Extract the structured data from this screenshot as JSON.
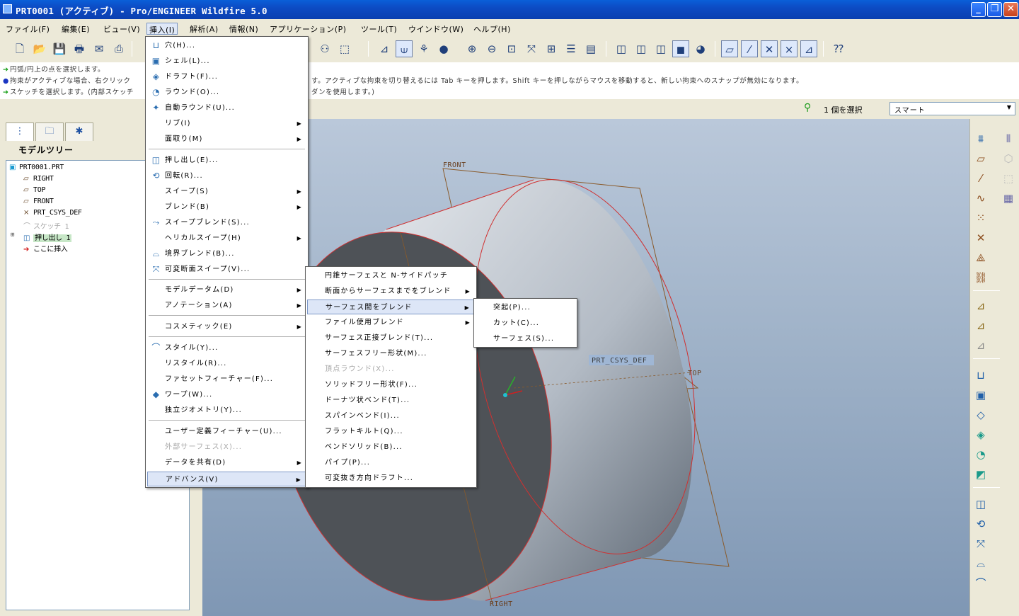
{
  "window": {
    "title": "PRT0001 (アクティブ) - Pro/ENGINEER Wildfire 5.0",
    "min": "_",
    "max": "❐",
    "close": "✕"
  },
  "menubar": [
    "ファイル(F)",
    "編集(E)",
    "ビュー(V)",
    "挿入(I)",
    "解析(A)",
    "情報(N)",
    "アプリケーション(P)",
    "ツール(T)",
    "ウインドウ(W)",
    "ヘルプ(H)"
  ],
  "messages": [
    "円弧/円上の点を選択します。",
    "拘束がアクティブな場合、右クリック",
    "スケッチを選択します。(内部スケッチ",
    "す。アクティブな拘束を切り替えるには Tab キーを押します。Shift キーを押しながらマウスを移動すると、新しい拘束へのスナップが無効になります。",
    "ダンを使用します。)"
  ],
  "selection": {
    "count": "1 個を選択",
    "filter": "スマート"
  },
  "tree": {
    "header": "モデルツリー",
    "items": [
      "PRT0001.PRT",
      "RIGHT",
      "TOP",
      "FRONT",
      "PRT_CSYS_DEF",
      "スケッチ 1",
      "押し出し 1",
      "ここに挿入"
    ]
  },
  "insert_menu": {
    "items": [
      "穴(H)...",
      "シェル(L)...",
      "ドラフト(F)...",
      "ラウンド(O)...",
      "自動ラウンド(U)...",
      "リブ(I)",
      "面取り(M)",
      "押し出し(E)...",
      "回転(R)...",
      "スイープ(S)",
      "ブレンド(B)",
      "スイープブレンド(S)...",
      "ヘリカルスイープ(H)",
      "境界ブレンド(B)...",
      "可変断面スイープ(V)...",
      "モデルデータム(D)",
      "アノテーション(A)",
      "コスメティック(E)",
      "スタイル(Y)...",
      "リスタイル(R)...",
      "ファセットフィーチャー(F)...",
      "ワープ(W)...",
      "独立ジオメトリ(Y)...",
      "ユーザー定義フィーチャー(U)...",
      "外部サーフェス(X)...",
      "データを共有(D)",
      "アドバンス(V)"
    ]
  },
  "advanced_menu": {
    "items": [
      "円錐サーフェスと N-サイドパッチ",
      "断面からサーフェスまでをブレンド",
      "サーフェス間をブレンド",
      "ファイル使用ブレンド",
      "サーフェス正接ブレンド(T)...",
      "サーフェスフリー形状(M)...",
      "頂点ラウンド(X)...",
      "ソリッドフリー形状(F)...",
      "ドーナツ状ベンド(T)...",
      "スパインベンド(I)...",
      "フラットキルト(Q)...",
      "ベンドソリッド(B)...",
      "パイプ(P)...",
      "可変抜き方向ドラフト..."
    ]
  },
  "blend_submenu": {
    "items": [
      "突起(P)...",
      "カット(C)...",
      "サーフェス(S)..."
    ]
  },
  "viewport": {
    "labels": [
      "FRONT",
      "TOP",
      "PRT_CSYS_DEF",
      "RIGHT"
    ]
  },
  "colors": {
    "titlebar": "#0a4fc8",
    "viewport_top": "#bac8da",
    "viewport_bottom": "#7f97b4",
    "body": "#b5bcc4",
    "edge": "#d03030",
    "datum": "#8a5a2a"
  }
}
